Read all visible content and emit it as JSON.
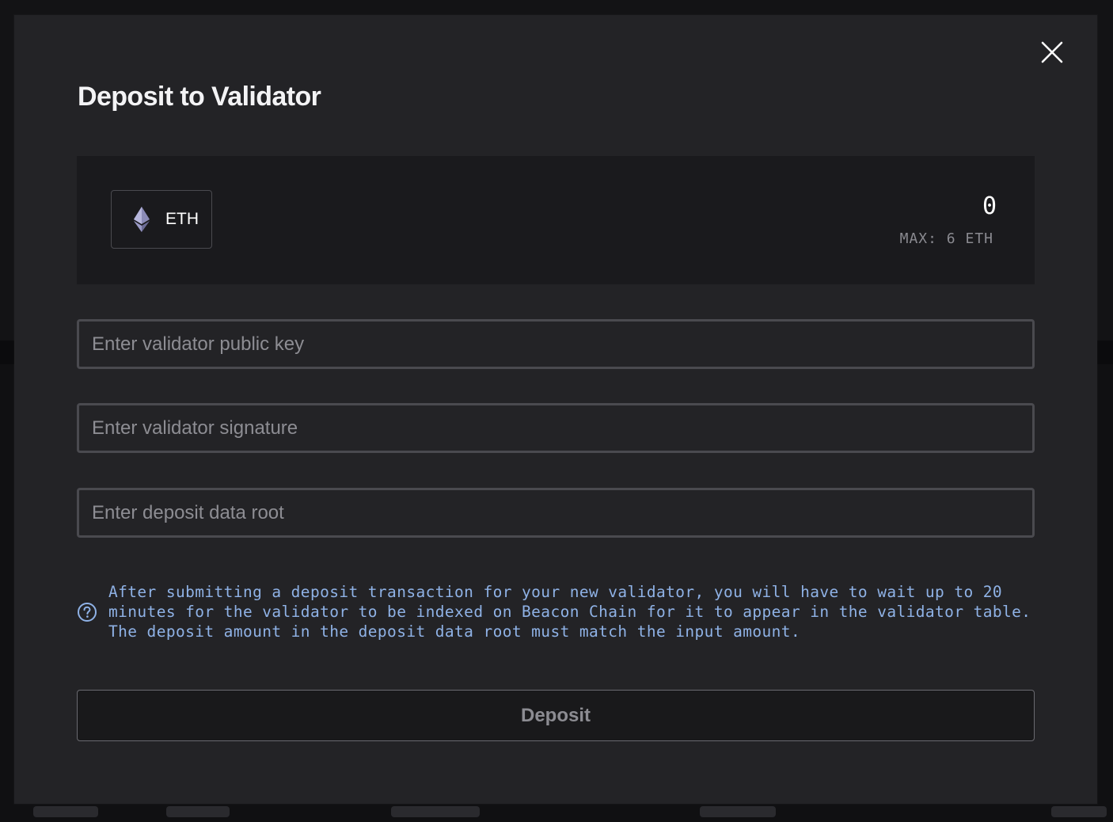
{
  "modal": {
    "title": "Deposit to Validator",
    "close_icon": "close-icon"
  },
  "amount": {
    "token_label": "ETH",
    "token_icon": "ethereum-icon",
    "value": "0",
    "max_label": "MAX: 6 ETH"
  },
  "fields": {
    "pubkey_placeholder": "Enter validator public key",
    "signature_placeholder": "Enter validator signature",
    "root_placeholder": "Enter deposit data root"
  },
  "notice": {
    "icon": "help-circle-icon",
    "text": "After submitting a deposit transaction for your new validator, you will have to wait up to 20 minutes for the validator to be indexed on Beacon Chain for it to appear in the validator table. The deposit amount in the deposit data root must match the input amount."
  },
  "actions": {
    "deposit_label": "Deposit"
  },
  "colors": {
    "modal_bg": "#232326",
    "panel_bg": "#1a1a1d",
    "notice_text": "#8fb2e6",
    "border": "#4a4a4f"
  }
}
